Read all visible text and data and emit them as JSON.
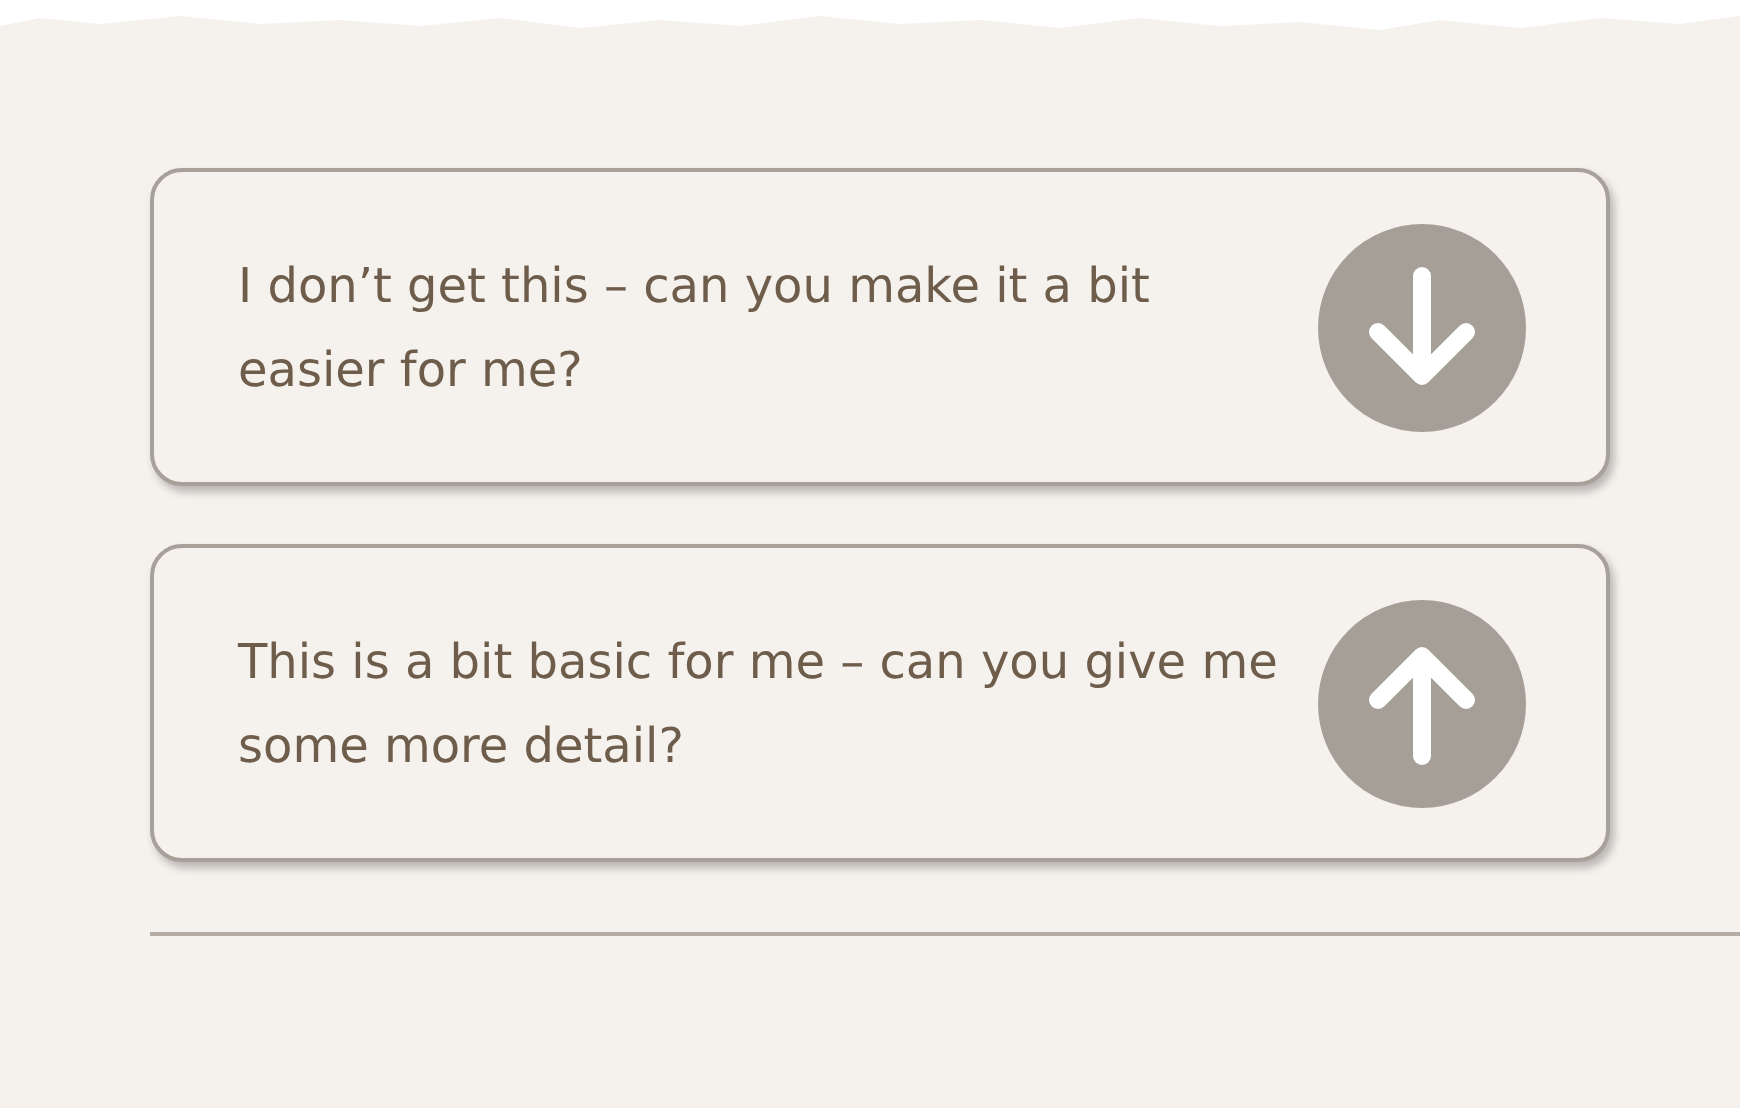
{
  "options": [
    {
      "text": "I don’t get this – can you make it a bit easier for me?",
      "kind": "down"
    },
    {
      "text": "This is a bit basic for me – can you give me some more detail?",
      "kind": "up"
    }
  ]
}
